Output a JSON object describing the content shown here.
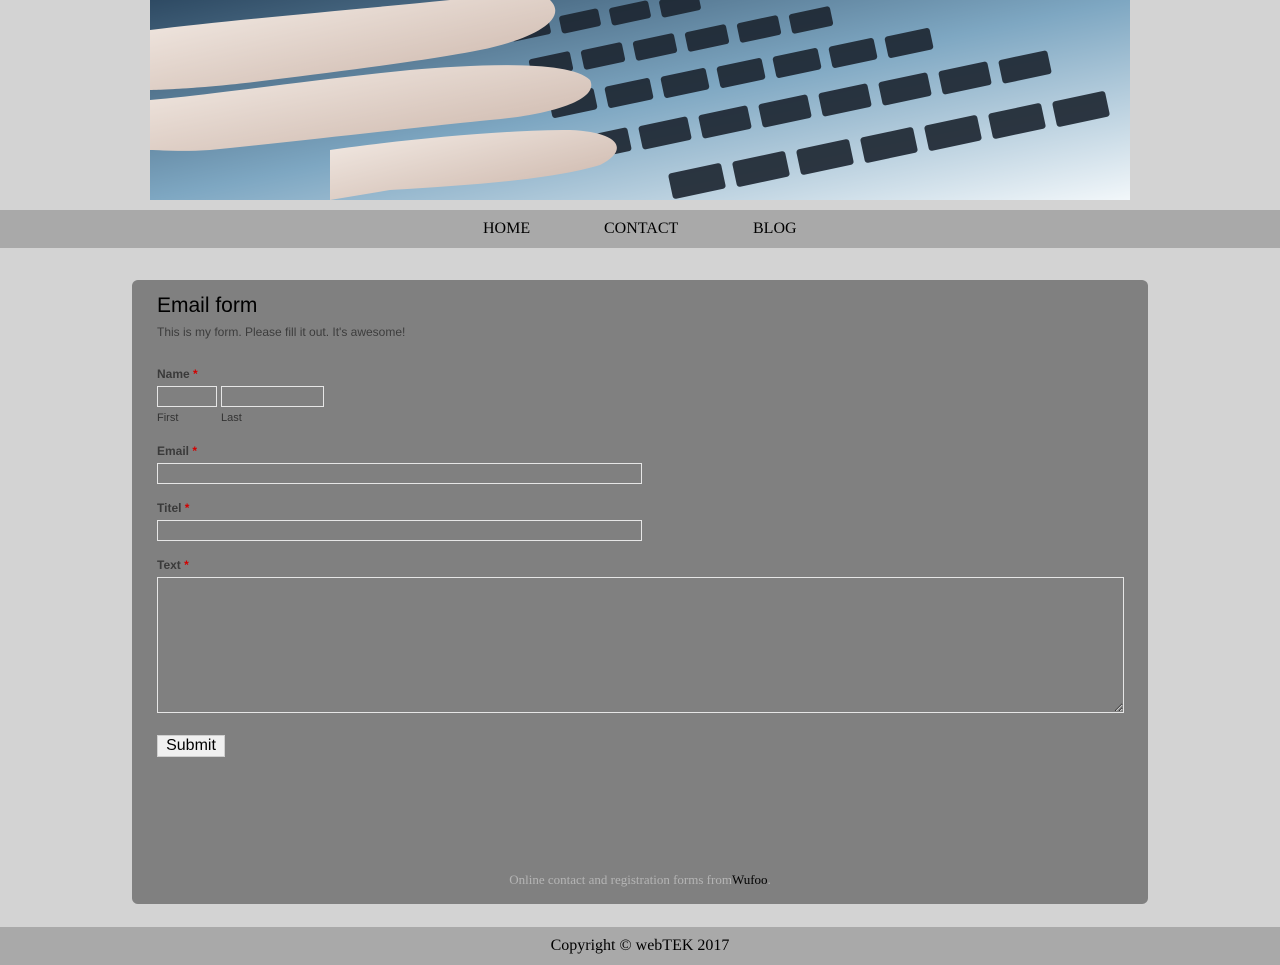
{
  "nav": {
    "items": [
      {
        "label": "HOME"
      },
      {
        "label": "CONTACT"
      },
      {
        "label": "BLOG"
      }
    ]
  },
  "form": {
    "title": "Email form",
    "description": "This is my form. Please fill it out. It's awesome!",
    "required_mark": "*",
    "name": {
      "label": "Name",
      "first_sublabel": "First",
      "last_sublabel": "Last",
      "first_value": "",
      "last_value": ""
    },
    "email": {
      "label": "Email",
      "value": ""
    },
    "title_field": {
      "label": "Titel",
      "value": ""
    },
    "text": {
      "label": "Text",
      "value": ""
    },
    "submit_label": "Submit",
    "powered_text": "Online contact and registration forms from",
    "powered_link": "Wufoo",
    "powered_suffix": "."
  },
  "footer": {
    "copyright": "Copyright © webTEK 2017"
  },
  "colors": {
    "page_bg": "#d3d3d3",
    "nav_bg": "#a9a9a9",
    "panel_bg": "#808080",
    "required": "#d30000"
  },
  "banner": {
    "image": "hands-on-keyboard-photo"
  }
}
